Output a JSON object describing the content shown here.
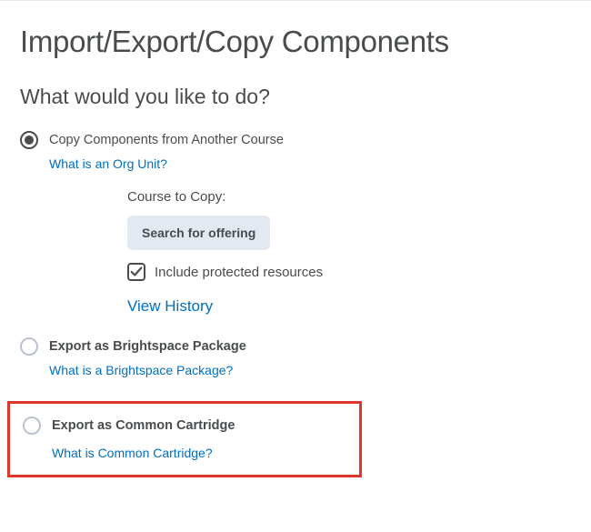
{
  "page": {
    "title": "Import/Export/Copy Components",
    "subtitle": "What would you like to do?"
  },
  "options": {
    "copy": {
      "label": "Copy Components from Another Course",
      "help_link": "What is an Org Unit?",
      "selected": true,
      "course_to_copy_label": "Course to Copy:",
      "search_button": "Search for offering",
      "include_protected_label": "Include protected resources",
      "include_protected_checked": true,
      "view_history_link": "View History"
    },
    "export_brightspace": {
      "label": "Export as Brightspace Package",
      "help_link": "What is a Brightspace Package?",
      "selected": false
    },
    "export_cartridge": {
      "label": "Export as Common Cartridge",
      "help_link": "What is Common Cartridge?",
      "selected": false
    }
  }
}
